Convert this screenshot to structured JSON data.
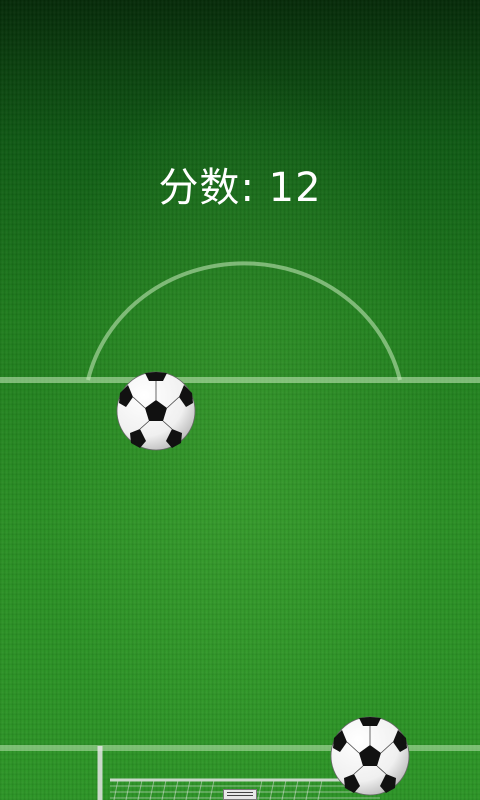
{
  "score": {
    "label": "分数",
    "separator": ": ",
    "value": "12"
  },
  "balls": [
    {
      "name": "soccer-ball"
    },
    {
      "name": "soccer-ball"
    }
  ],
  "colors": {
    "grass_dark": "#052a08",
    "grass_mid": "#1f7d1d",
    "grass_light": "#2c9526",
    "line": "#9fd28f",
    "text": "#ffffff"
  }
}
